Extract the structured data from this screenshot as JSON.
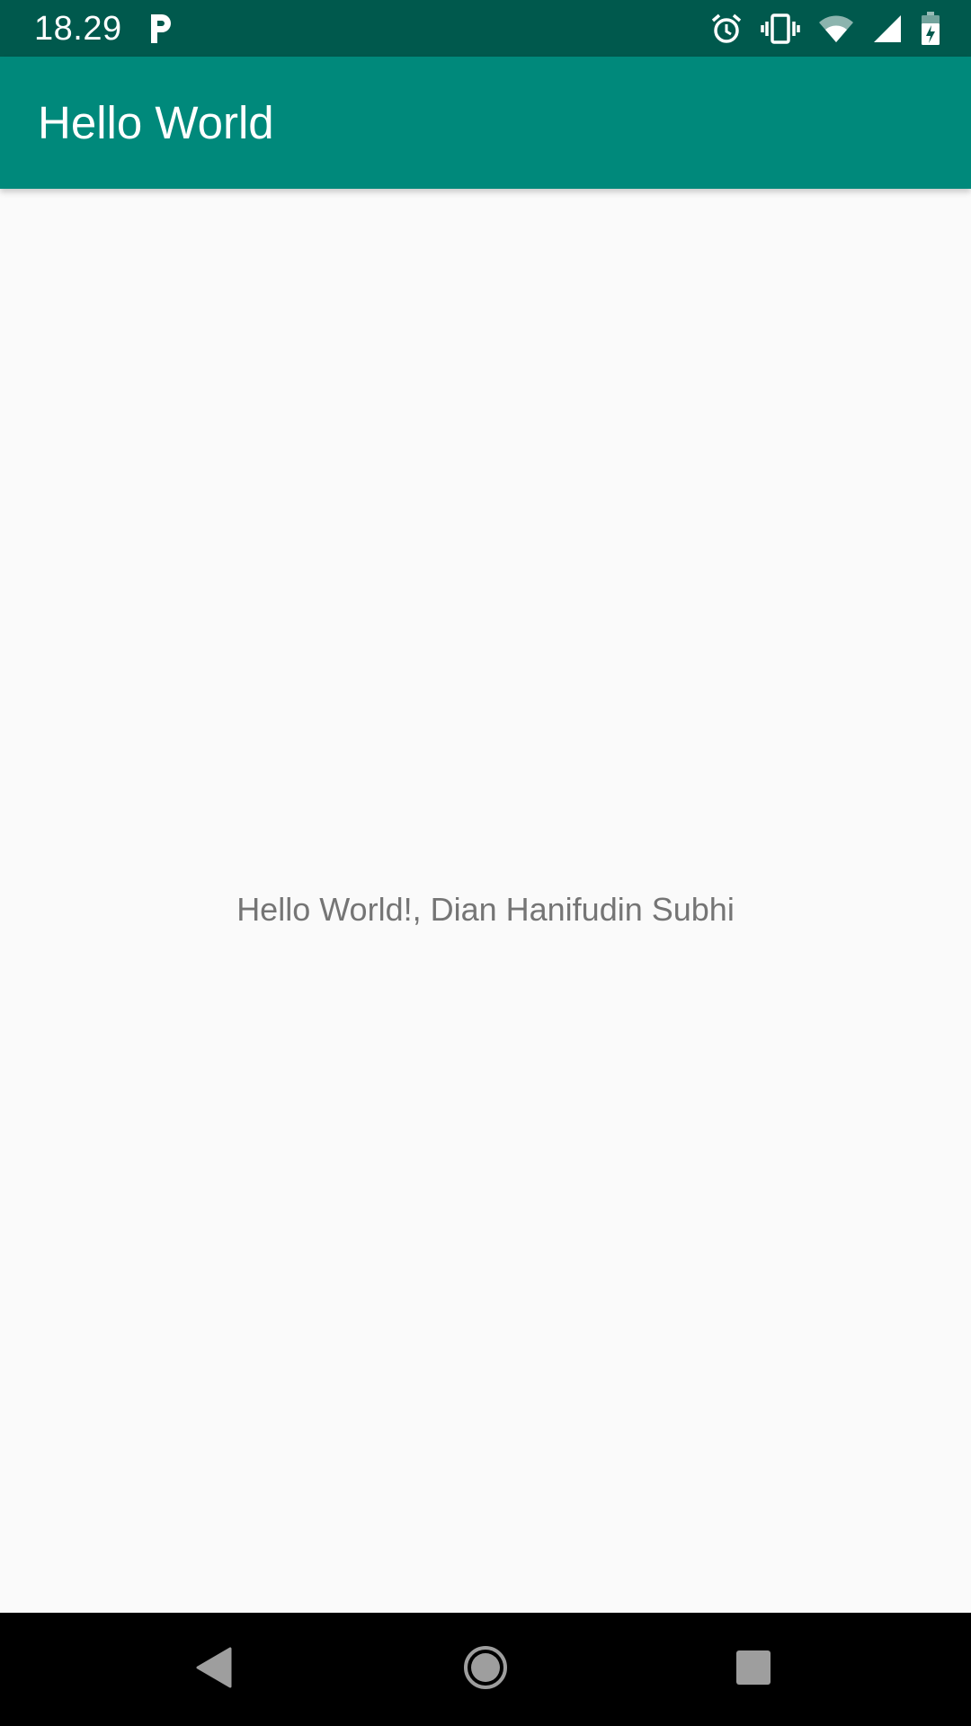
{
  "status_bar": {
    "time": "18.29",
    "notification_icon": "parking-p-icon",
    "icons": [
      "alarm-icon",
      "vibrate-icon",
      "wifi-icon",
      "cell-signal-icon",
      "battery-icon"
    ],
    "colors": {
      "background": "#00594d",
      "foreground": "#ffffff"
    }
  },
  "app_bar": {
    "title": "Hello World",
    "colors": {
      "background": "#00897b",
      "foreground": "#ffffff"
    }
  },
  "main": {
    "message": "Hello World!, Dian Hanifudin Subhi",
    "colors": {
      "background": "#fafafa",
      "text": "#757575"
    }
  },
  "nav_bar": {
    "buttons": [
      "back-icon",
      "home-icon",
      "recents-icon"
    ],
    "colors": {
      "background": "#000000",
      "icon": "#9e9e9e"
    }
  }
}
